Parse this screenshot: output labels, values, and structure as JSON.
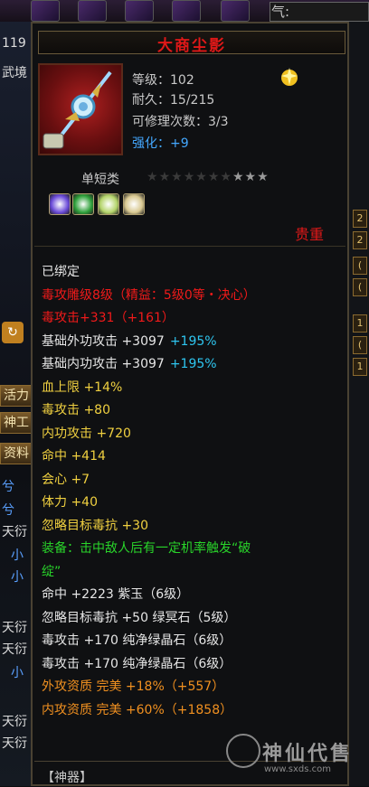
{
  "top": {
    "qi_label": "气:"
  },
  "left_column": {
    "level_partial": "119",
    "realm": "武境",
    "tab_huoli": "活力",
    "tab_shengong": "神工",
    "tab_ziliao": "资料",
    "rows": [
      "兮",
      "兮",
      "天衍",
      "小",
      "小",
      "天衍",
      "天衍",
      "小",
      "天衍",
      "天衍"
    ]
  },
  "item": {
    "name": "大商尘影",
    "level_label": "等级：",
    "level": "102",
    "durability_label": "耐久：",
    "durability": "15/215",
    "repair_label": "可修理次数：",
    "repair": "3/3",
    "enhance_label": "强化：",
    "enhance": "+9",
    "category": "单短类",
    "stars_filled": 7,
    "stars_total": 10,
    "valuable_label": "贵重",
    "gems": [
      {
        "name": "purple-gem-icon",
        "color": "#6a4ad8"
      },
      {
        "name": "green-gem-icon",
        "color": "#2ea03a"
      },
      {
        "name": "green-gem-icon-2",
        "color": "#b4d46a"
      },
      {
        "name": "green-gem-icon-3",
        "color": "#d8c890"
      }
    ]
  },
  "attributes": [
    {
      "text": "已绑定",
      "color": "white"
    },
    {
      "text": "毒攻雕级8级（精益：5级0等・决心）",
      "color": "red"
    },
    {
      "text": "毒攻击+331（+161）",
      "color": "red"
    },
    {
      "text": "基础外功攻击 +3097",
      "extra": "+195%",
      "color": "white",
      "extra_color": "cyan"
    },
    {
      "text": "基础内功攻击 +3097",
      "extra": "+195%",
      "color": "white",
      "extra_color": "cyan"
    },
    {
      "text": "血上限 +14%",
      "color": "gold"
    },
    {
      "text": "毒攻击 +80",
      "color": "gold"
    },
    {
      "text": "内功攻击 +720",
      "color": "gold"
    },
    {
      "text": "命中 +414",
      "color": "gold"
    },
    {
      "text": "会心 +7",
      "color": "gold"
    },
    {
      "text": "体力 +40",
      "color": "gold"
    },
    {
      "text": "忽略目标毒抗 +30",
      "color": "gold"
    },
    {
      "text": "装备：击中敌人后有一定机率触发“破",
      "color": "green"
    },
    {
      "text": "绽”",
      "color": "green"
    },
    {
      "text": "命中 +2223 紫玉（6级）",
      "color": "white"
    },
    {
      "text": "忽略目标毒抗 +50 绿冥石（5级）",
      "color": "white"
    },
    {
      "text": "毒攻击 +170 纯净绿晶石（6级）",
      "color": "white"
    },
    {
      "text": "毒攻击 +170 纯净绿晶石（6级）",
      "color": "white"
    },
    {
      "text": "外攻资质  完美 +18%（+557）",
      "color": "orange"
    },
    {
      "text": "内攻资质  完美 +60%（+1858）",
      "color": "orange"
    }
  ],
  "bottom": {
    "label": "【神器】"
  },
  "watermark": {
    "text": "神仙代售",
    "url": "www.sxds.com"
  },
  "colors": {
    "red": "#f01a1a",
    "gold": "#f0d040",
    "green": "#29d42a",
    "cyan": "#2ec6f0",
    "orange": "#f09020"
  }
}
